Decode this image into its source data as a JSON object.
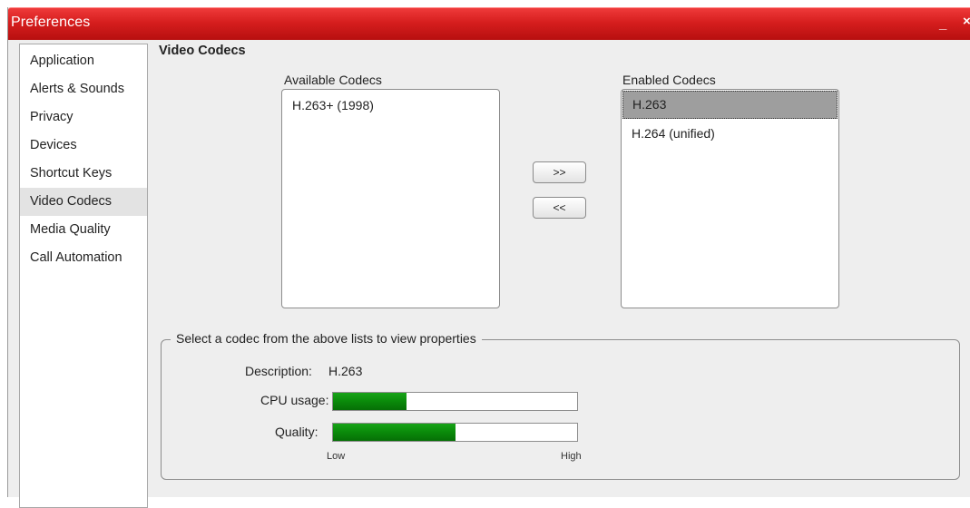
{
  "window": {
    "title": "Preferences",
    "minimize_label": "_",
    "close_label": "×"
  },
  "nav": {
    "items": [
      {
        "label": "Application"
      },
      {
        "label": "Alerts & Sounds"
      },
      {
        "label": "Privacy"
      },
      {
        "label": "Devices"
      },
      {
        "label": "Shortcut Keys"
      },
      {
        "label": "Video Codecs",
        "selected": true
      },
      {
        "label": "Media Quality"
      },
      {
        "label": "Call Automation"
      }
    ]
  },
  "page": {
    "title": "Video Codecs",
    "available": {
      "label": "Available Codecs",
      "items": [
        "H.263+ (1998)"
      ]
    },
    "enabled": {
      "label": "Enabled Codecs",
      "items": [
        "H.263",
        "H.264 (unified)"
      ],
      "selected_index": 0
    },
    "buttons": {
      "add": ">>",
      "remove": "<<"
    },
    "properties": {
      "legend": "Select a codec from the above lists to view properties",
      "description_label": "Description:",
      "description_value": "H.263",
      "cpu_label": "CPU usage:",
      "cpu_fraction": 0.3,
      "quality_label": "Quality:",
      "quality_fraction": 0.5,
      "scale_low": "Low",
      "scale_high": "High"
    }
  },
  "colors": {
    "titlebar": "#d61e1e",
    "meter_fill": "#0a8a0a",
    "selection": "#9e9e9e"
  }
}
